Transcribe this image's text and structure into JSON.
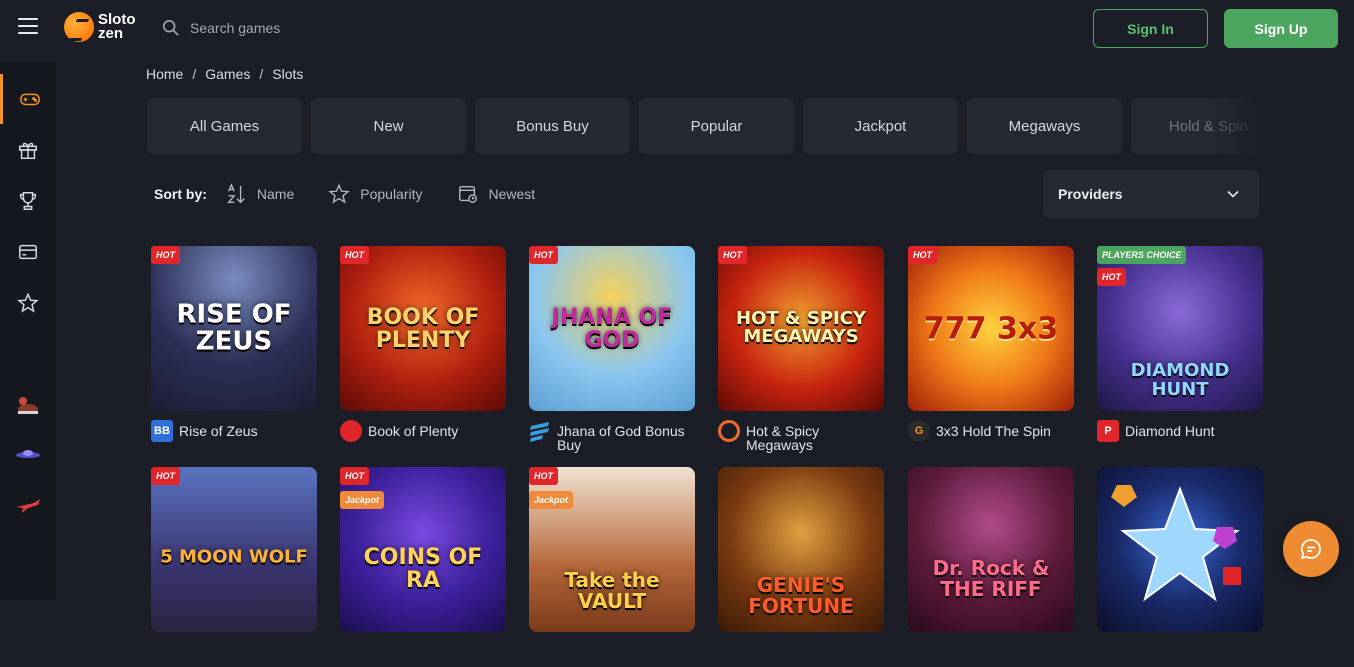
{
  "header": {
    "logo_line1": "Sloto",
    "logo_line2": "zen",
    "search_placeholder": "Search games",
    "signin_label": "Sign In",
    "signup_label": "Sign Up"
  },
  "sidebar": {
    "items": [
      {
        "icon": "gamepad-icon",
        "active": true
      },
      {
        "icon": "gift-icon",
        "active": false
      },
      {
        "icon": "trophy-icon",
        "active": false
      },
      {
        "icon": "wallet-icon",
        "active": false
      },
      {
        "icon": "star-icon",
        "active": false
      }
    ],
    "mini_games": [
      "duck-game-icon",
      "spaceship-game-icon",
      "plane-game-icon"
    ]
  },
  "breadcrumb": {
    "items": [
      "Home",
      "Games",
      "Slots"
    ],
    "separator": "/"
  },
  "categories": [
    "All Games",
    "New",
    "Bonus Buy",
    "Popular",
    "Jackpot",
    "Megaways",
    "Hold & Spin"
  ],
  "sort": {
    "label": "Sort by:",
    "options": [
      "Name",
      "Popularity",
      "Newest"
    ]
  },
  "providers_label": "Providers",
  "games_row1": [
    {
      "name": "Rise of Zeus",
      "art": "RISE OF ZEUS",
      "badges": [
        "HOT"
      ],
      "provider_icon": "BB"
    },
    {
      "name": "Book of Plenty",
      "art": "BOOK OF PLENTY",
      "badges": [
        "HOT"
      ],
      "provider_icon": "flame"
    },
    {
      "name": "Jhana of God Bonus Buy",
      "art": "JHANA OF GOD",
      "badges": [
        "HOT"
      ],
      "provider_icon": "stripes"
    },
    {
      "name": "Hot & Spicy Megaways",
      "art": "HOT & SPICY MEGAWAYS",
      "badges": [
        "HOT"
      ],
      "provider_icon": "ring"
    },
    {
      "name": "3x3 Hold The Spin",
      "art": "777 3x3",
      "badges": [
        "HOT"
      ],
      "provider_icon": "G"
    },
    {
      "name": "Diamond Hunt",
      "art": "DIAMOND HUNT",
      "badges": [
        "PLAYERS CHOICE",
        "HOT"
      ],
      "provider_icon": "P"
    }
  ],
  "games_row2": [
    {
      "art": "5 MOON WOLF",
      "badges": [
        "HOT"
      ]
    },
    {
      "art": "COINS OF RA",
      "badges": [
        "HOT",
        "Jackpot"
      ]
    },
    {
      "art": "Take the VAULT",
      "badges": [
        "HOT",
        "Jackpot"
      ]
    },
    {
      "art": "GENIE'S FORTUNE",
      "badges": []
    },
    {
      "art": "Dr. Rock & THE RIFF",
      "badges": []
    },
    {
      "art": "",
      "badges": []
    }
  ],
  "colors": {
    "background": "#1b1e26",
    "accent_orange": "#f39325",
    "green": "#4ca55e",
    "hot_red": "#e0262b"
  }
}
